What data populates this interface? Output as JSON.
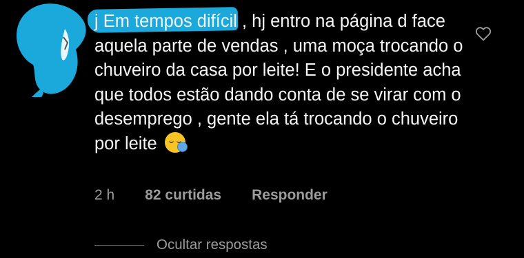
{
  "comment": {
    "username": "j",
    "text": "Em tempos difícil , hj entro na página d face  aquela parte de vendas , uma moça trocando o chuveiro da casa por leite! E o presidente acha que todos estão  dando conta de se virar com o desemprego , gente ela tá trocando o chuveiro por leite",
    "emoji": "sleepy-face-emoji",
    "time": "2 h",
    "likes": "82 curtidas",
    "reply_label": "Responder",
    "liked": false
  },
  "replies": {
    "toggle_label": "Ocultar respostas"
  },
  "icons": {
    "like": "heart-outline-icon",
    "avatar": "redacted-avatar"
  },
  "colors": {
    "background": "#000000",
    "text": "#f5f5f5",
    "muted": "#9c9c9c",
    "redaction": "#1ba9dc"
  }
}
